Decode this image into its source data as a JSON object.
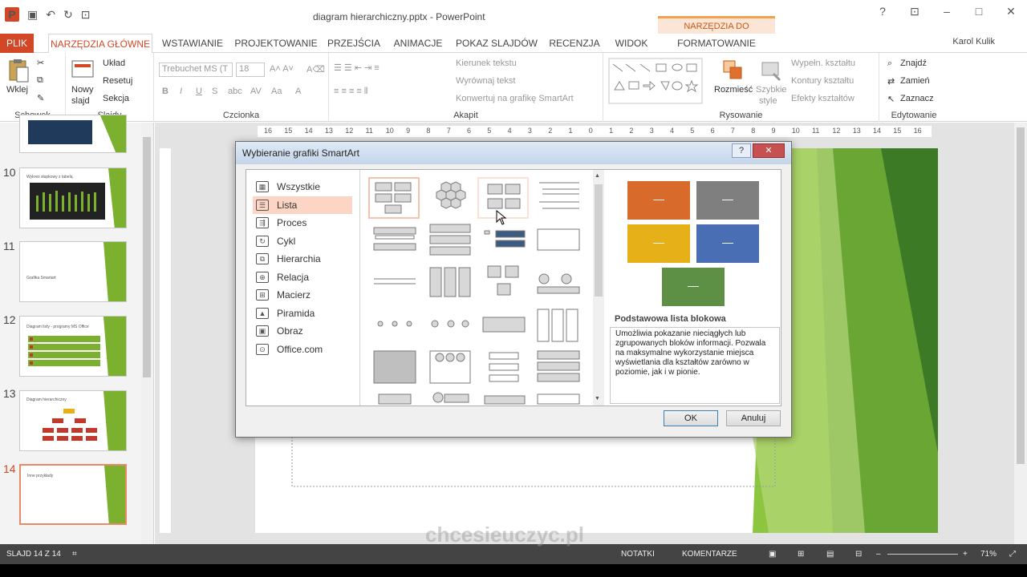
{
  "window": {
    "title": "diagram hierarchiczny.pptx - PowerPoint",
    "context_header": "NARZĘDZIA DO RYSOWANIA",
    "user": "Karol Kulik"
  },
  "tabs": [
    "PLIK",
    "NARZĘDZIA GŁÓWNE",
    "WSTAWIANIE",
    "PROJEKTOWANIE",
    "PRZEJŚCIA",
    "ANIMACJE",
    "POKAZ SLAJDÓW",
    "RECENZJA",
    "WIDOK",
    "FORMATOWANIE"
  ],
  "ribbon": {
    "clipboard": {
      "paste": "Wklej",
      "label": "Schowek"
    },
    "slides": {
      "new_slide_1": "Nowy",
      "new_slide_2": "slajd",
      "layout": "Układ",
      "reset": "Resetuj",
      "section": "Sekcja",
      "label": "Slajdy"
    },
    "font": {
      "font_name": "Trebuchet MS (T",
      "font_size": "18",
      "label": "Czcionka"
    },
    "paragraph": {
      "text_direction": "Kierunek tekstu",
      "align_text": "Wyrównaj tekst",
      "convert": "Konwertuj na grafikę SmartArt",
      "label": "Akapit"
    },
    "drawing": {
      "arrange": "Rozmieść",
      "quick_styles_1": "Szybkie",
      "quick_styles_2": "style",
      "fill": "Wypełn. kształtu",
      "outline": "Kontury kształtu",
      "effects": "Efekty kształtów",
      "label": "Rysowanie"
    },
    "editing": {
      "find": "Znajdź",
      "replace": "Zamień",
      "select": "Zaznacz",
      "label": "Edytowanie"
    }
  },
  "ruler": {
    "marks": [
      "16",
      "15",
      "14",
      "13",
      "12",
      "11",
      "10",
      "9",
      "8",
      "7",
      "6",
      "5",
      "4",
      "3",
      "2",
      "1",
      "0",
      "1",
      "2",
      "3",
      "4",
      "5",
      "6",
      "7",
      "8",
      "9",
      "10",
      "11",
      "12",
      "13",
      "14",
      "15",
      "16"
    ]
  },
  "slides": [
    {
      "num": "10",
      "text": "Wykres słupkowy z tabelą"
    },
    {
      "num": "11",
      "text": "Grafika Smartart"
    },
    {
      "num": "12",
      "text": "Diagram listy - programy MS Office"
    },
    {
      "num": "13",
      "text": "Diagram hierarchiczny"
    },
    {
      "num": "14",
      "text": "Inne przykłady"
    }
  ],
  "dialog": {
    "title": "Wybieranie grafiki SmartArt",
    "help": "?",
    "close": "✕",
    "categories": [
      "Wszystkie",
      "Lista",
      "Proces",
      "Cykl",
      "Hierarchia",
      "Relacja",
      "Macierz",
      "Piramida",
      "Obraz",
      "Office.com"
    ],
    "selected_category": "Lista",
    "preview_name": "Podstawowa lista blokowa",
    "preview_desc": "Umożliwia pokazanie nieciągłych lub zgrupowanych bloków informacji. Pozwala na maksymalne wykorzystanie miejsca wyświetlania dla kształtów zarówno w poziomie, jak i w pionie.",
    "ok": "OK",
    "cancel": "Anuluj",
    "preview_colors": [
      "#d86a2b",
      "#7f7f7f",
      "#e6b019",
      "#4a6eb4",
      "#5d8f45"
    ]
  },
  "status": {
    "slide": "SLAJD 14 Z 14",
    "notes": "NOTATKI",
    "comments": "KOMENTARZE",
    "zoom": "71%"
  },
  "watermark": "chcesieuczyc.pl"
}
